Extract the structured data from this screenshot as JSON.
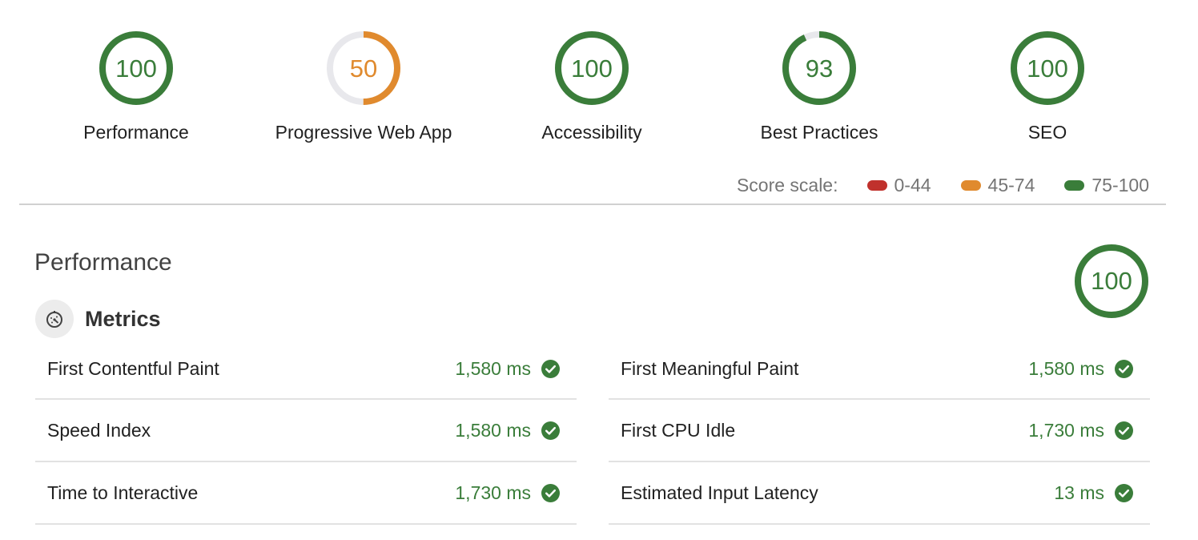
{
  "colors": {
    "pass": "#3a7d3a",
    "average": "#e08a2e",
    "fail": "#c0312c",
    "track": "#e8e8ec"
  },
  "gauges": [
    {
      "label": "Performance",
      "score": "100",
      "fraction": 1.0,
      "rating": "pass",
      "icon": "score-gauge"
    },
    {
      "label": "Progressive Web App",
      "score": "50",
      "fraction": 0.5,
      "rating": "average",
      "icon": "score-gauge"
    },
    {
      "label": "Accessibility",
      "score": "100",
      "fraction": 1.0,
      "rating": "pass",
      "icon": "score-gauge"
    },
    {
      "label": "Best Practices",
      "score": "93",
      "fraction": 0.93,
      "rating": "pass",
      "icon": "score-gauge"
    },
    {
      "label": "SEO",
      "score": "100",
      "fraction": 1.0,
      "rating": "pass",
      "icon": "score-gauge"
    }
  ],
  "score_scale": {
    "title": "Score scale:",
    "items": [
      {
        "label": "0-44",
        "color": "#c0312c"
      },
      {
        "label": "45-74",
        "color": "#e08a2e"
      },
      {
        "label": "75-100",
        "color": "#3a7d3a"
      }
    ]
  },
  "performance": {
    "title": "Performance",
    "score": "100",
    "fraction": 1.0,
    "metrics_title": "Metrics",
    "metrics_icon": "stopwatch-icon",
    "metrics_left": [
      {
        "name": "First Contentful Paint",
        "value": "1,580 ms",
        "status": "pass"
      },
      {
        "name": "Speed Index",
        "value": "1,580 ms",
        "status": "pass"
      },
      {
        "name": "Time to Interactive",
        "value": "1,730 ms",
        "status": "pass"
      }
    ],
    "metrics_right": [
      {
        "name": "First Meaningful Paint",
        "value": "1,580 ms",
        "status": "pass"
      },
      {
        "name": "First CPU Idle",
        "value": "1,730 ms",
        "status": "pass"
      },
      {
        "name": "Estimated Input Latency",
        "value": "13 ms",
        "status": "pass"
      }
    ]
  }
}
